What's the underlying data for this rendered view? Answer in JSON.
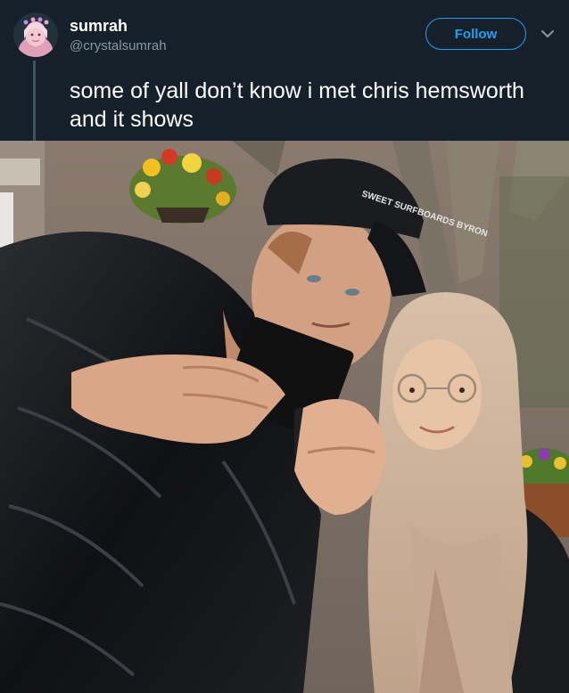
{
  "tweet": {
    "user": {
      "name": "sumrah",
      "handle": "@crystalsumrah"
    },
    "follow_label": "Follow",
    "text": "some of yall don’t know i met chris hemsworth and it shows",
    "menu_icon": "chevron-down-icon",
    "cap_text": "SWEET SURFBOARDS BYRON"
  },
  "colors": {
    "background": "#15202b",
    "accent": "#1da1f2",
    "secondary_text": "#8899a6"
  }
}
